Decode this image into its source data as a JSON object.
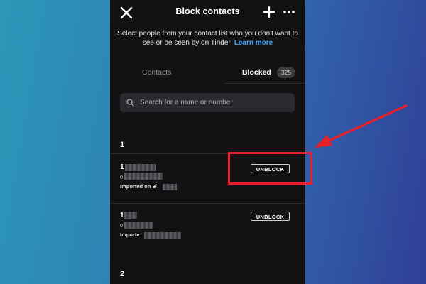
{
  "header": {
    "title": "Block contacts",
    "close_icon": "close-icon",
    "add_icon": "plus-icon",
    "more_icon": "more-dots-icon"
  },
  "description": {
    "text": "Select people from your contact list who you don't want to see or be seen by on Tinder.",
    "link": "Learn more"
  },
  "tabs": {
    "contacts": "Contacts",
    "blocked": "Blocked",
    "blocked_count": "325"
  },
  "search": {
    "placeholder": "Search for a name or number",
    "value": ""
  },
  "sections": [
    {
      "header": "1",
      "items": [
        {
          "name": "1",
          "phone": "0",
          "imported": "Imported on 3/",
          "action": "UNBLOCK"
        },
        {
          "name": "1",
          "phone": "0",
          "imported": "Importe",
          "action": "UNBLOCK"
        }
      ]
    },
    {
      "header": "2"
    }
  ],
  "annotation": {
    "color": "#e8202a"
  },
  "colors": {
    "app_background": "#121214",
    "link": "#3aa6ff",
    "search_background": "#2a2b2f"
  }
}
